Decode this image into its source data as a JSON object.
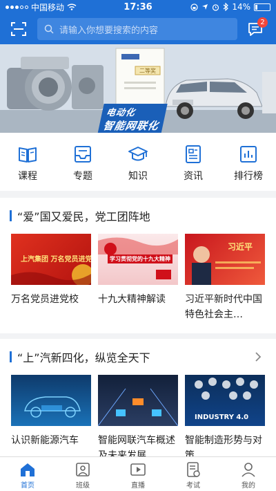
{
  "status_bar": {
    "carrier": "中国移动",
    "time": "17:36",
    "battery": "14%",
    "battery_level": 0.14
  },
  "search": {
    "placeholder": "请输入你想要搜索的内容"
  },
  "messages": {
    "badge_count": "2"
  },
  "banner": {
    "caption_line1": "电动化",
    "caption_line2": "智能网联化",
    "certificate_label": "二等奖"
  },
  "categories": [
    {
      "label": "课程",
      "icon": "book-icon"
    },
    {
      "label": "专题",
      "icon": "tray-icon"
    },
    {
      "label": "知识",
      "icon": "graduation-cap-icon"
    },
    {
      "label": "资讯",
      "icon": "document-icon"
    },
    {
      "label": "排行榜",
      "icon": "bar-chart-icon"
    }
  ],
  "sections": [
    {
      "title": "“爱”国又爱民，党工团阵地",
      "cards": [
        {
          "title": "万名党员进党校",
          "thumb_text": "上汽集团 万名党员进党校"
        },
        {
          "title": "十九大精神解读",
          "thumb_text": "学习贯彻党的十九大精神"
        },
        {
          "title": "习近平新时代中国特色社会主…",
          "thumb_text": "习近平"
        }
      ]
    },
    {
      "title": "“上”汽新四化，纵览全天下",
      "cards": [
        {
          "title": "认识新能源汽车",
          "thumb_text": ""
        },
        {
          "title": "智能网联汽车概述及未来发展",
          "thumb_text": ""
        },
        {
          "title": "智能制造形势与对策",
          "thumb_text": "INDUSTRY 4.0"
        }
      ]
    }
  ],
  "tabs": [
    {
      "label": "首页",
      "icon": "home-icon",
      "active": true
    },
    {
      "label": "班级",
      "icon": "class-icon",
      "active": false
    },
    {
      "label": "直播",
      "icon": "live-icon",
      "active": false
    },
    {
      "label": "考试",
      "icon": "exam-icon",
      "active": false
    },
    {
      "label": "我的",
      "icon": "user-icon",
      "active": false
    }
  ],
  "colors": {
    "primary": "#1f70d6",
    "badge": "#f2463a",
    "party_red": "#c8161d"
  }
}
